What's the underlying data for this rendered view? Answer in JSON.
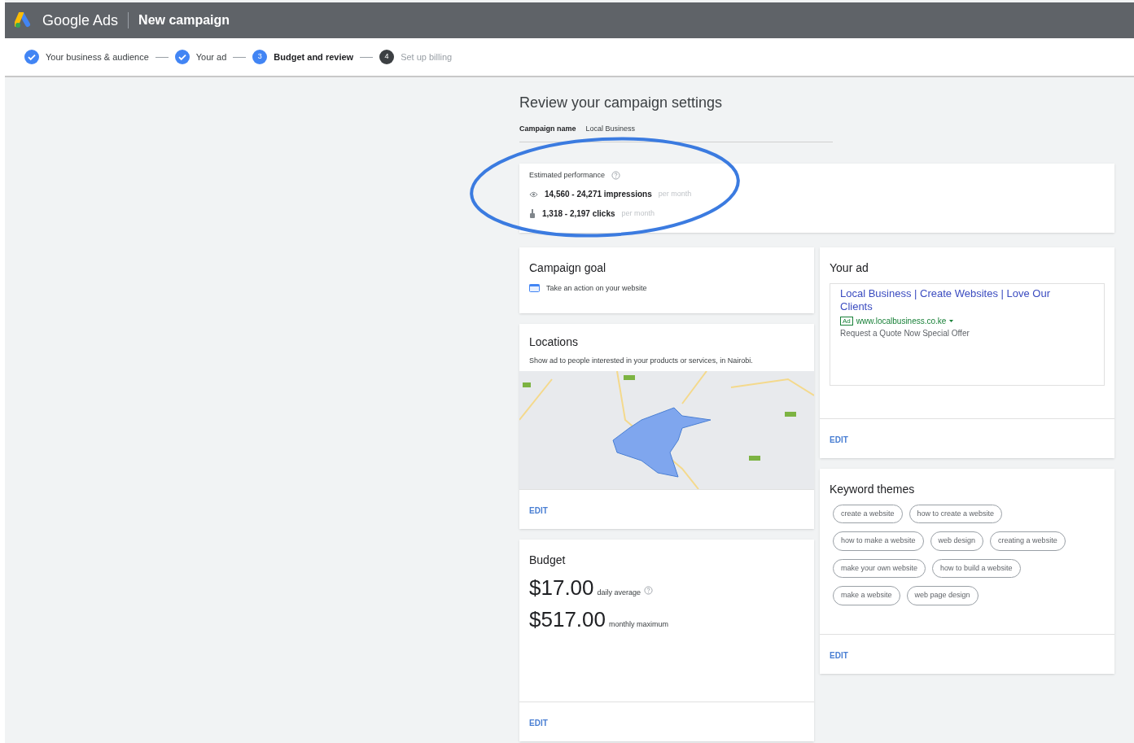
{
  "header": {
    "product": "Google Ads",
    "title": "New campaign"
  },
  "steps": [
    {
      "label": "Your business & audience",
      "kind": "done"
    },
    {
      "label": "Your ad",
      "kind": "done"
    },
    {
      "label": "Budget and review",
      "kind": "current",
      "number": "3"
    },
    {
      "label": "Set up billing",
      "kind": "upcoming",
      "number": "4"
    }
  ],
  "page_title": "Review your campaign settings",
  "campaign_name": {
    "label": "Campaign name",
    "value": "Local Business"
  },
  "estimated_performance": {
    "title": "Estimated performance",
    "rows": [
      {
        "kind": "impressions",
        "value": "14,560 - 24,271 impressions",
        "unit": "per month"
      },
      {
        "kind": "clicks",
        "value": "1,318 - 2,197 clicks",
        "unit": "per month"
      }
    ]
  },
  "campaign_goal": {
    "title": "Campaign goal",
    "goal": "Take an action on your website"
  },
  "locations": {
    "title": "Locations",
    "description": "Show ad to people interested in your products or services, in Nairobi.",
    "edit": "EDIT"
  },
  "budget": {
    "title": "Budget",
    "daily": "$17.00",
    "daily_label": "daily average",
    "monthly": "$517.00",
    "monthly_label": "monthly maximum",
    "edit": "EDIT"
  },
  "your_ad": {
    "title": "Your ad",
    "headline": "Local Business | Create Websites | Love Our Clients",
    "badge": "Ad",
    "url": "www.localbusiness.co.ke",
    "description": "Request a Quote Now Special Offer",
    "edit": "EDIT"
  },
  "keyword_themes": {
    "title": "Keyword themes",
    "rows": [
      [
        "create a website",
        "how to create a website"
      ],
      [
        "how to make a website",
        "web design",
        "creating a website"
      ],
      [
        "make your own website",
        "how to build a website"
      ],
      [
        "make a website",
        "web page design"
      ]
    ],
    "edit": "EDIT"
  }
}
